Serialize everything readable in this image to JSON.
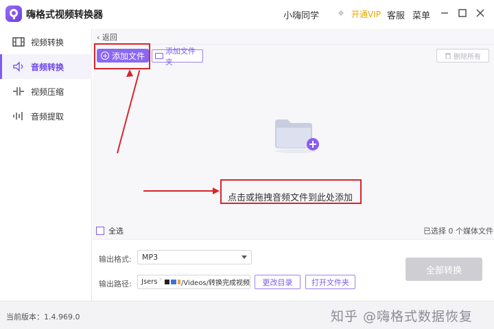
{
  "app": {
    "title": "嗨格式视频转换器",
    "user_name": "小嗨同学",
    "vip_label": "开通VIP",
    "service_label": "客服",
    "menu_label": "菜单"
  },
  "sidebar": {
    "items": [
      {
        "label": "视频转换",
        "icon": "video-convert-icon",
        "active": false
      },
      {
        "label": "音频转换",
        "icon": "audio-convert-icon",
        "active": true
      },
      {
        "label": "视频压缩",
        "icon": "compress-icon",
        "active": false
      },
      {
        "label": "音频提取",
        "icon": "audio-extract-icon",
        "active": false
      }
    ]
  },
  "toolbar": {
    "back_label": "返回",
    "add_file_label": "添加文件",
    "add_folder_label": "添加文件夹",
    "delete_all_label": "删除所有"
  },
  "dropzone": {
    "hint": "点击或拖拽音频文件到此处添加"
  },
  "list_footer": {
    "select_all_label": "全选",
    "selected_count": "已选择 0 个媒体文件"
  },
  "output": {
    "format_label": "输出格式:",
    "format_value": "MP3",
    "path_label": "输出路径:",
    "path_prefix": "Jsers",
    "path_suffix": "/Videos/转换完成视频",
    "change_dir_label": "更改目录",
    "open_folder_label": "打开文件夹",
    "convert_all_label": "全部转换"
  },
  "status": {
    "version": "当前版本：1.4.969.0",
    "watermark": "知乎 @嗨格式数据恢复"
  },
  "colors": {
    "accent": "#8b67f2",
    "annotation": "#d8232a",
    "vip": "#e7a600"
  }
}
